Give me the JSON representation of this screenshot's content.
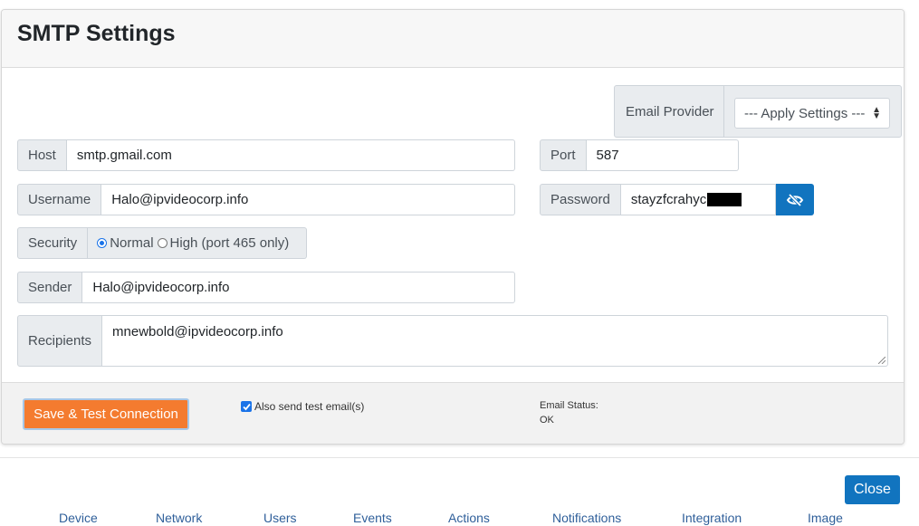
{
  "dialog": {
    "title": "SMTP Settings"
  },
  "email_provider": {
    "label": "Email Provider",
    "selected": "--- Apply Settings ---"
  },
  "host": {
    "label": "Host",
    "value": "smtp.gmail.com"
  },
  "port": {
    "label": "Port",
    "value": "587"
  },
  "username": {
    "label": "Username",
    "value": "Halo@ipvideocorp.info"
  },
  "password": {
    "label": "Password",
    "value_visible": "stayzfcrahyc"
  },
  "security": {
    "label": "Security",
    "options": [
      "Normal",
      "High (port 465 only)"
    ],
    "selected": "Normal"
  },
  "sender": {
    "label": "Sender",
    "value": "Halo@ipvideocorp.info"
  },
  "recipients": {
    "label": "Recipients",
    "value": "mnewbold@ipvideocorp.info"
  },
  "footer": {
    "save_button": "Save & Test Connection",
    "also_send_test": "Also send test email(s)",
    "email_status_label": "Email Status:",
    "email_status_value": "OK"
  },
  "close_button": "Close",
  "background_nav": [
    "Device",
    "Network",
    "Users",
    "Events",
    "Actions",
    "Notifications",
    "Integration",
    "Image"
  ],
  "colors": {
    "primary": "#1174bf",
    "save": "#f47b2f"
  }
}
